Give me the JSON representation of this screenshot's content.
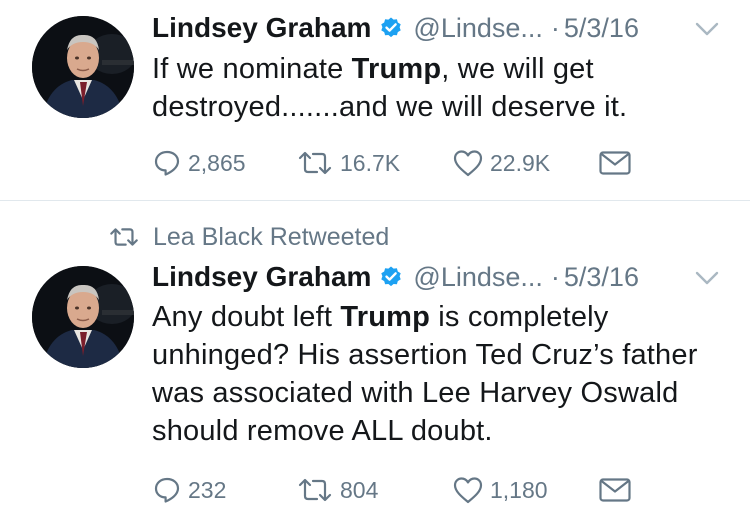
{
  "tweets": [
    {
      "author": {
        "name": "Lindsey Graham",
        "handle": "@Lindse...",
        "verified": true
      },
      "separator": "·",
      "date": "5/3/16",
      "text_parts": {
        "before": "If we nominate ",
        "bold": "Trump",
        "after": ", we will get destroyed.......and we will deserve it."
      },
      "stats": {
        "replies": "2,865",
        "retweets": "16.7K",
        "likes": "22.9K"
      }
    },
    {
      "retweeted_by": "Lea Black Retweeted",
      "author": {
        "name": "Lindsey Graham",
        "handle": "@Lindse...",
        "verified": true
      },
      "separator": "·",
      "date": "5/3/16",
      "text_parts": {
        "before": "Any doubt left ",
        "bold": "Trump",
        "after": " is completely unhinged? His assertion Ted Cruz’s father was associated with Lee Harvey Oswald should remove ALL doubt."
      },
      "stats": {
        "replies": "232",
        "retweets": "804",
        "likes": "1,180"
      }
    }
  ],
  "colors": {
    "text": "#14171a",
    "secondary": "#657786",
    "verified": "#1da1f2",
    "divider": "#e1e8ed"
  },
  "icons": {
    "reply": "reply-icon",
    "retweet": "retweet-icon",
    "like": "heart-icon",
    "message": "envelope-icon",
    "verified": "verified-badge-icon",
    "caret": "chevron-down-icon"
  }
}
